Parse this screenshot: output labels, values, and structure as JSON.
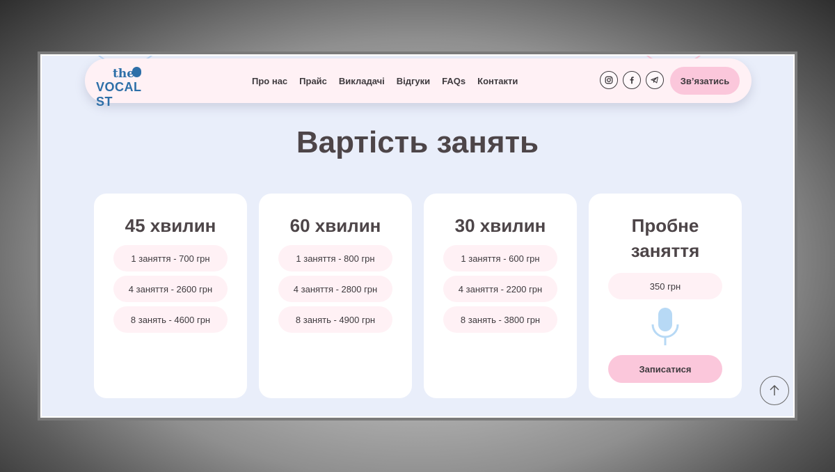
{
  "brand": {
    "logo_text_top": "the",
    "logo_text_bottom": "VOCAL ST",
    "color": "#2d6fa8"
  },
  "nav": {
    "items": [
      {
        "label": "Про нас"
      },
      {
        "label": "Прайс"
      },
      {
        "label": "Викладачі"
      },
      {
        "label": "Відгуки"
      },
      {
        "label": "FAQs"
      },
      {
        "label": "Контакти"
      }
    ]
  },
  "socials": [
    "instagram-icon",
    "facebook-icon",
    "telegram-icon"
  ],
  "header": {
    "contact_label": "Зв’язатись"
  },
  "page": {
    "title": "Вартість занять"
  },
  "plans": [
    {
      "title": "45 хвилин",
      "prices": [
        "1 заняття - 700 грн",
        "4 заняття - 2600 грн",
        "8 занять - 4600 грн"
      ]
    },
    {
      "title": "60 хвилин",
      "prices": [
        "1 заняття - 800 грн",
        "4 заняття - 2800 грн",
        "8 занять - 4900 грн"
      ]
    },
    {
      "title": "30 хвилин",
      "prices": [
        "1 заняття - 600 грн",
        "4 заняття - 2200 грн",
        "8 занять - 3800 грн"
      ]
    }
  ],
  "trial": {
    "title_line1": "Пробне",
    "title_line2": "заняття",
    "price": "350 грн",
    "button_label": "Записатися",
    "icon": "microphone-icon"
  },
  "colors": {
    "accent_pink": "#fbc7db",
    "pill_bg": "#fff1f5",
    "page_bg": "#e9eefa",
    "mic_blue": "#b7d9f5"
  }
}
